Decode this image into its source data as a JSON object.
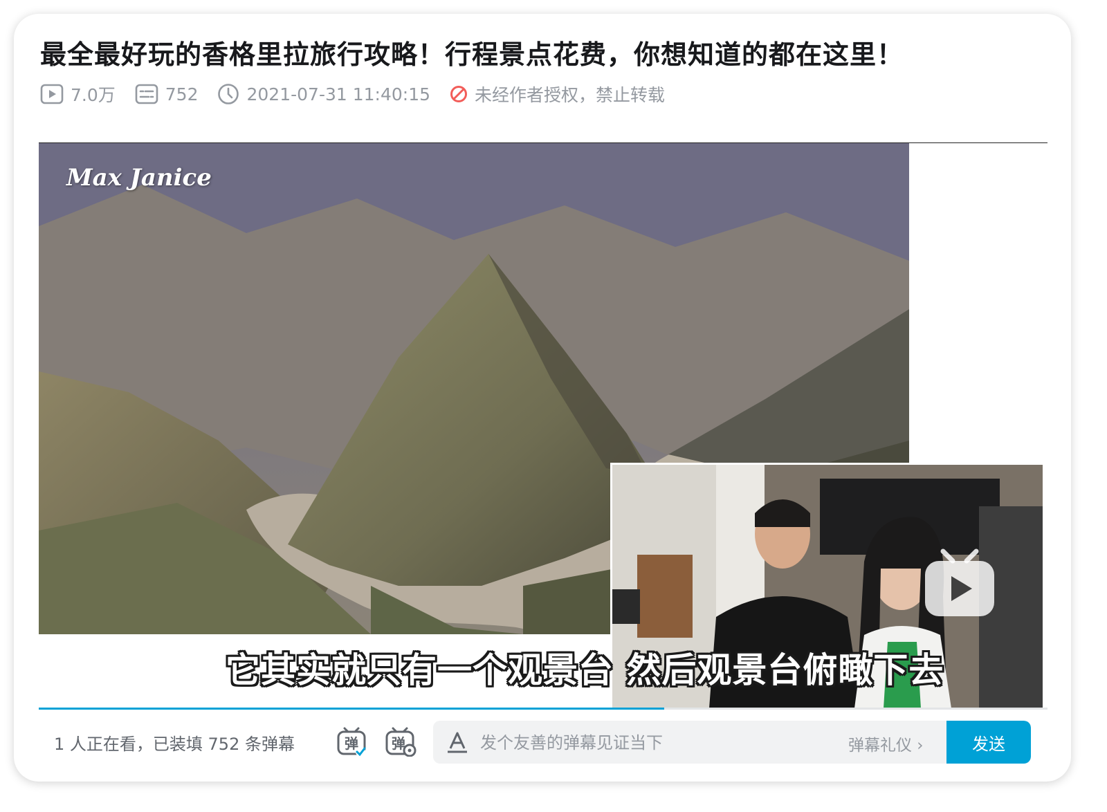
{
  "video": {
    "title": "最全最好玩的香格里拉旅行攻略！行程景点花费，你想知道的都在这里！",
    "views": "7.0万",
    "danmaku_count": "752",
    "publish_time": "2021-07-31 11:40:15",
    "copyright_notice": "未经作者授权，禁止转载"
  },
  "player": {
    "watermark": "Max Janice",
    "subtitle": "它其实就只有一个观景台 然后观景台俯瞰下去",
    "progress_fraction": 0.62
  },
  "danmaku_bar": {
    "viewer_status": "1 人正在看，已装填 752 条弹幕",
    "toggle_icon_char": "弹",
    "input_placeholder": "发个友善的弹幕见证当下",
    "etiquette_label": "弹幕礼仪 ›",
    "send_label": "发送"
  },
  "colors": {
    "accent": "#00a1d6",
    "warning": "#f25d59",
    "meta_text": "#9499a0",
    "title_text": "#18191c"
  },
  "icons": [
    "play-count-icon",
    "danmaku-count-icon",
    "clock-icon",
    "no-reprint-icon",
    "danmaku-toggle-icon",
    "danmaku-settings-icon",
    "font-style-icon",
    "play-icon"
  ]
}
